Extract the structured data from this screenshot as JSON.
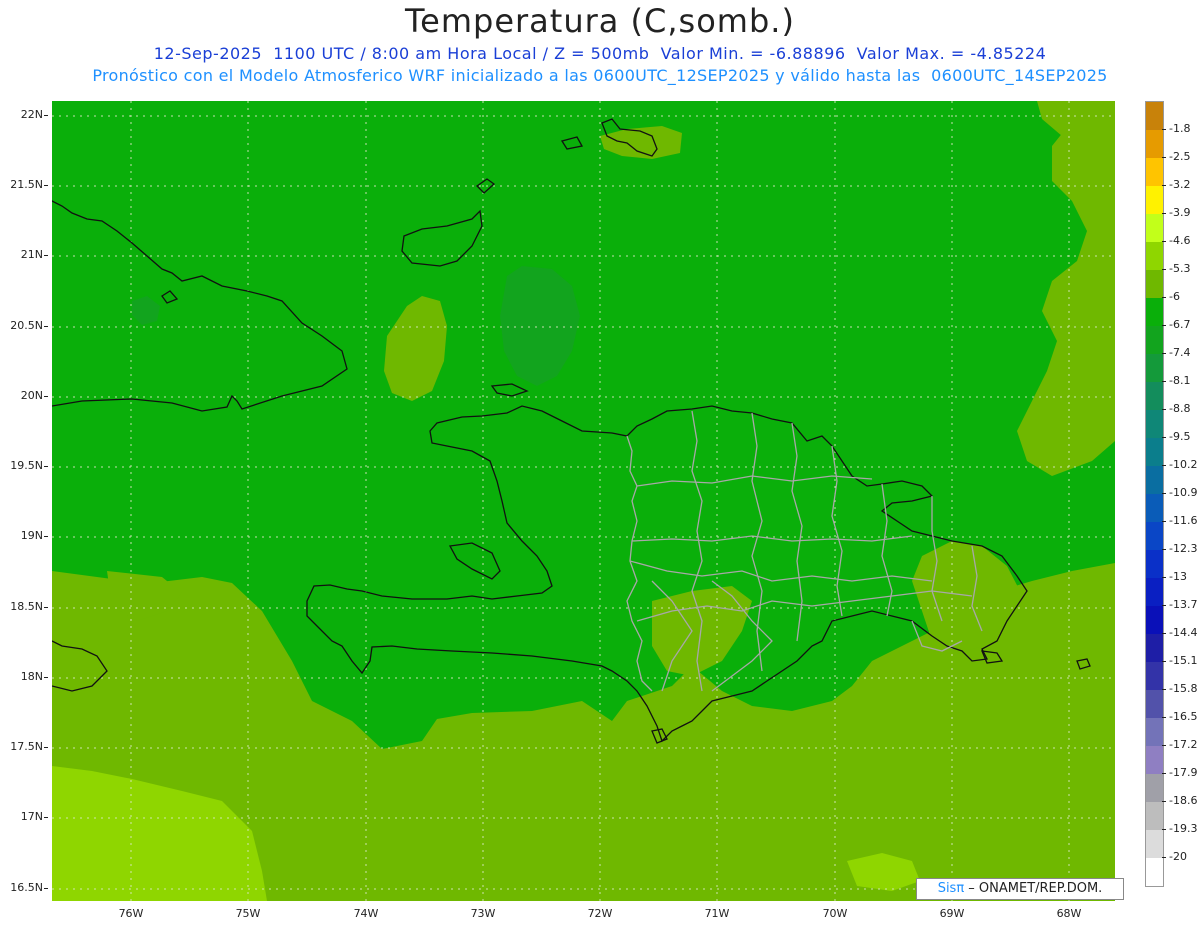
{
  "header": {
    "title": "Temperatura (C,somb.)",
    "line1": "12-Sep-2025  1100 UTC / 8:00 am Hora Local / Z = 500mb  Valor Min. = -6.88896  Valor Max. = -4.85224",
    "line2": "Pronóstico con el Modelo Atmosferico WRF inicializado a las 0600UTC_12SEP2025 y válido hasta las  0600UTC_14SEP2025"
  },
  "axes": {
    "lat_labels": [
      "22N",
      "21.5N",
      "21N",
      "20.5N",
      "20N",
      "19.5N",
      "19N",
      "18.5N",
      "18N",
      "17.5N",
      "17N",
      "16.5N"
    ],
    "lon_labels": [
      "76W",
      "75W",
      "74W",
      "73W",
      "72W",
      "71W",
      "70W",
      "69W",
      "68W"
    ]
  },
  "legend": {
    "labels": [
      "-1.8",
      "-2.5",
      "-3.2",
      "-3.9",
      "-4.6",
      "-5.3",
      "-6",
      "-6.7",
      "-7.4",
      "-8.1",
      "-8.8",
      "-9.5",
      "-10.2",
      "-10.9",
      "-11.6",
      "-12.3",
      "-13",
      "-13.7",
      "-14.4",
      "-15.1",
      "-15.8",
      "-16.5",
      "-17.2",
      "-17.9",
      "-18.6",
      "-19.3",
      "-20"
    ],
    "colors": [
      "#c8820a",
      "#e69b00",
      "#ffc400",
      "#fff200",
      "#c2ff1a",
      "#8fd600",
      "#6fb800",
      "#0aaf0a",
      "#12a41e",
      "#149a3a",
      "#138d5c",
      "#0f8777",
      "#0b7e8c",
      "#0a6ea1",
      "#0a5cb8",
      "#0a46c6",
      "#0a30c8",
      "#0a1fc2",
      "#0a10b8",
      "#1e1ea6",
      "#3333a8",
      "#5252aa",
      "#7373b8",
      "#8f7fc2",
      "#a0a0a8",
      "#bdbdbd",
      "#dcdcdc",
      "#ffffff"
    ]
  },
  "field_colors": {
    "base": "#0aaf0a",
    "warmer": "#6fb800",
    "warmest": "#8fd600",
    "cooler": "#12a41e"
  },
  "credit": {
    "brand": "Sisπ",
    "text": " – ONAMET/REP.DOM."
  }
}
